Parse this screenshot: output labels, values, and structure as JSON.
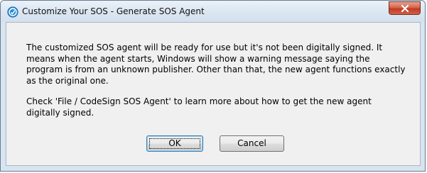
{
  "window": {
    "title": "Customize Your SOS - Generate SOS Agent"
  },
  "message": {
    "paragraph1_line1": "The customized SOS agent will be ready for use but it's not been digitally signed. It",
    "paragraph1_line2": "means when the agent starts, Windows will show a warning message saying the",
    "paragraph1_line3": "program is from an unknown publisher. Other than that, the new agent functions exactly",
    "paragraph1_line4": "as the original one.",
    "paragraph2_line1": "Check 'File / CodeSign SOS Agent' to learn more about how to get the new agent",
    "paragraph2_line2": "digitally signed."
  },
  "buttons": {
    "ok_label": "OK",
    "cancel_label": "Cancel"
  },
  "icons": {
    "app": "sos-app-icon",
    "close": "close-icon"
  },
  "colors": {
    "close_button": "#c23b22",
    "default_button_border": "#3c7fb1"
  }
}
